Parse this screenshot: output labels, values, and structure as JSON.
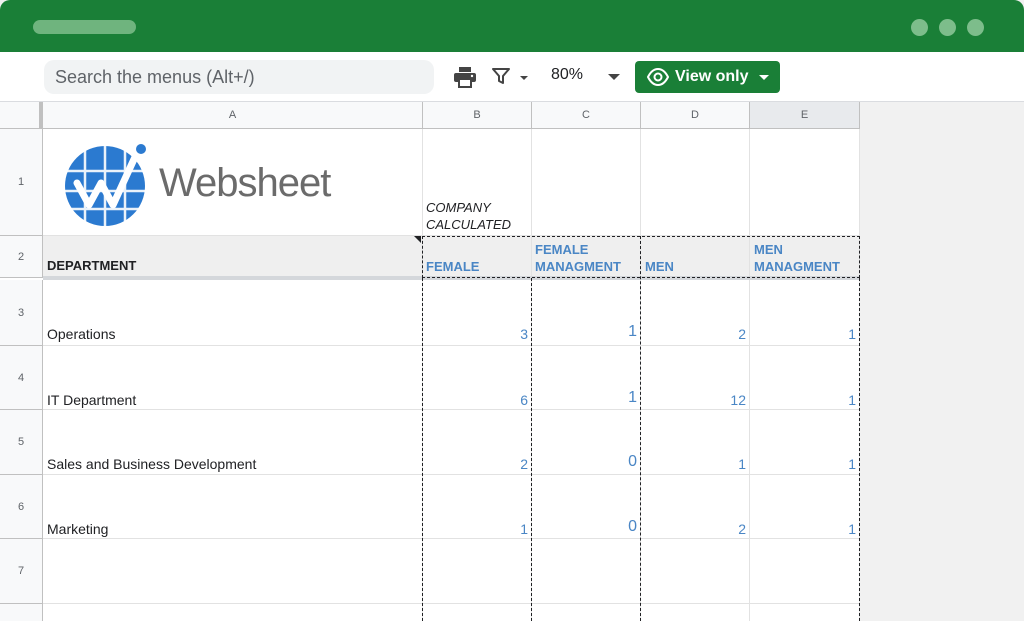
{
  "toolbar": {
    "search_placeholder": "Search the menus (Alt+/)",
    "zoom": "80%",
    "view_only_label": "View only"
  },
  "colors": {
    "titlebar": "#1a7f37",
    "accent_text": "#4a86c5"
  },
  "icons": [
    "print-icon",
    "filter-icon",
    "eye-icon"
  ],
  "logo_text": "Websheet",
  "columns": [
    "A",
    "B",
    "C",
    "D",
    "E"
  ],
  "rows": [
    "1",
    "2",
    "3",
    "4",
    "5",
    "6",
    "7"
  ],
  "row1": {
    "b": "COMPANY CALCULATED"
  },
  "header_row": {
    "department": "DEPARTMENT",
    "female": "FEMALE",
    "female_managment": "FEMALE MANAGMENT",
    "men": "MEN",
    "men_managment": "MEN MANAGMENT"
  },
  "data_rows": [
    {
      "department": "Operations",
      "female": "3",
      "female_managment": "1",
      "men": "2",
      "men_managment": "1"
    },
    {
      "department": "IT Department",
      "female": "6",
      "female_managment": "1",
      "men": "12",
      "men_managment": "1"
    },
    {
      "department": "Sales and Business Development",
      "female": "2",
      "female_managment": "0",
      "men": "1",
      "men_managment": "1"
    },
    {
      "department": "Marketing",
      "female": "1",
      "female_managment": "0",
      "men": "2",
      "men_managment": "1"
    }
  ]
}
